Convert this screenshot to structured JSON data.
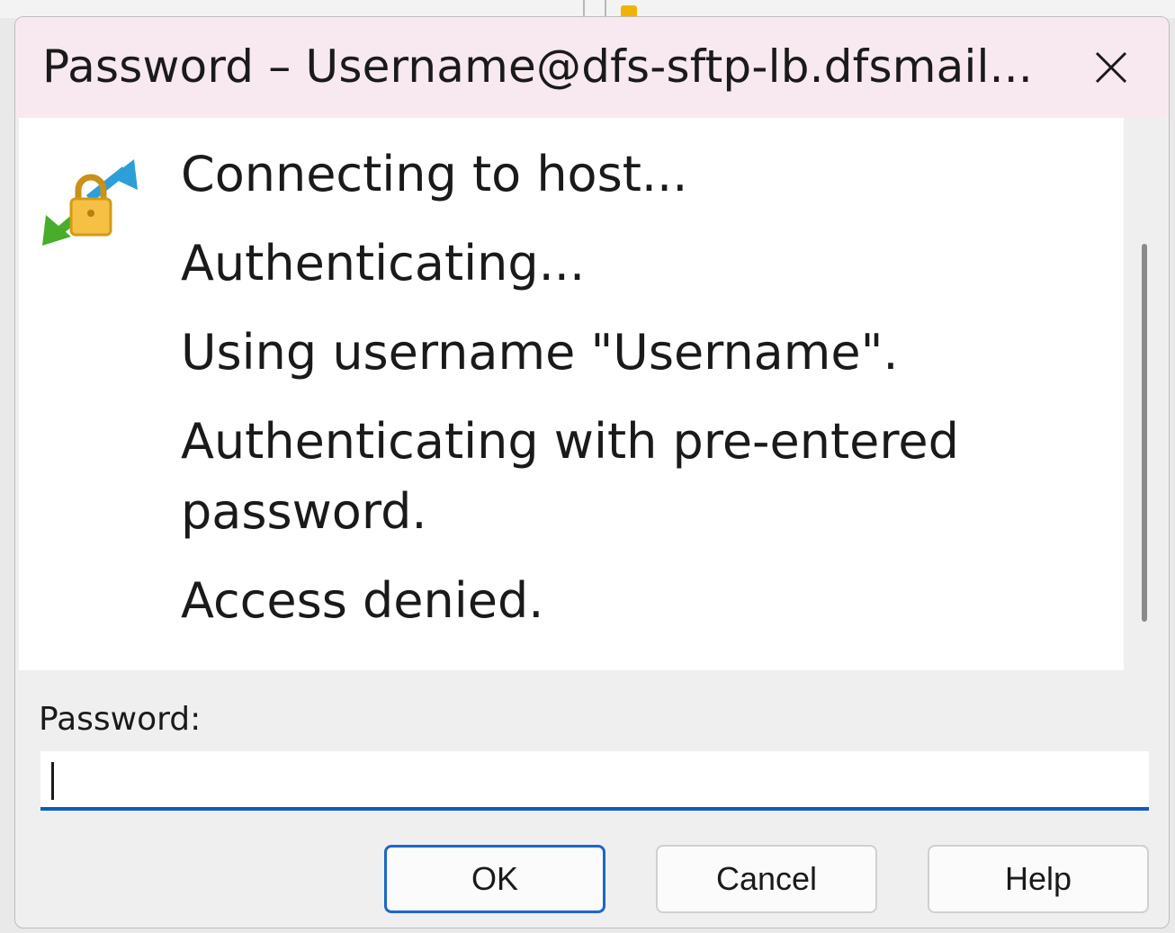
{
  "dialog": {
    "title": "Password – Username@dfs-sftp-lb.dfsmail...",
    "close_icon": "close-icon",
    "status_icon": "lock-transfer-icon"
  },
  "log": {
    "lines": [
      "Connecting to host...",
      "Authenticating...",
      "Using username \"Username\".",
      "Authenticating with pre-entered password.",
      "Access denied."
    ]
  },
  "password": {
    "label": "Password:",
    "value": ""
  },
  "buttons": {
    "ok": "OK",
    "cancel": "Cancel",
    "help": "Help"
  },
  "colors": {
    "titlebar": "#f8e8ef",
    "focus_accent": "#0a5cc2"
  }
}
